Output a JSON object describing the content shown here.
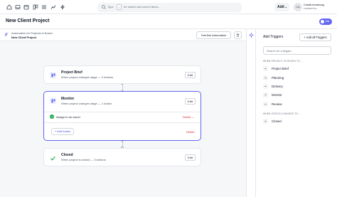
{
  "topbar": {
    "search": {
      "type_label": "Type",
      "shortcut_key": "/",
      "hint": "for search and recent items..."
    },
    "add_label": "Add",
    "user": {
      "initials": "CA",
      "name": "Charlie Armstrong",
      "org": "Linetweet Inc."
    }
  },
  "header": {
    "title": "New Client Project",
    "toggle_label": "On"
  },
  "breadcrumb": {
    "parent": "Automation for Projects in Board",
    "current": "New Client Project"
  },
  "toolbar": {
    "test_label": "Test this Automation"
  },
  "stages": [
    {
      "title": "Project Brief",
      "subtitle": "When project changes stage — 0 Actions",
      "edit": "Edit"
    },
    {
      "title": "Monitor",
      "subtitle": "When project changes stage — 1 Action",
      "edit": "Edit",
      "action": "Assign to an owner",
      "delete": "Delete",
      "add_action": "+ Add Action",
      "stage_delete": "Delete"
    },
    {
      "title": "Closed",
      "subtitle": "When project is closed — 0 Actions",
      "edit": "Edit"
    }
  ],
  "triggers": {
    "title": "Add Triggers",
    "add_all": "+ Add all Triggers",
    "search_placeholder": "Search for a trigger...",
    "moved_heading": "WHEN PROJECT IS MOVED TO...",
    "moved_items": [
      "Project Brief",
      "Planning",
      "Delivery",
      "Monitor",
      "Review"
    ],
    "status_heading": "WHEN STATUS CHANGES TO...",
    "status_items": [
      "Closed"
    ]
  },
  "colors": {
    "accent": "#6366f1",
    "danger": "#dc2626",
    "success": "#16a34a"
  }
}
